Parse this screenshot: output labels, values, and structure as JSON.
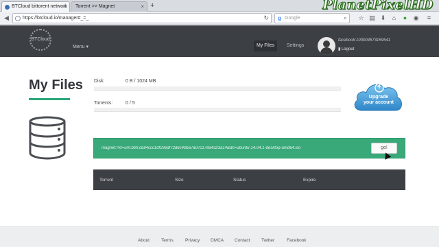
{
  "browser": {
    "tabs": [
      {
        "label": "BTCloud bittorent network",
        "close": "×"
      },
      {
        "label": "Torrent >> Magnet",
        "close": "×"
      }
    ],
    "new_tab": "+",
    "url": "https://btcloud.io/manager#_=_",
    "search_placeholder": "Google",
    "watermark": "PlanetPixelHD"
  },
  "header": {
    "logo_text": "BTCloud",
    "menu_label": "Menu ▾",
    "nav": {
      "my_files": "My Files",
      "settings": "Settings"
    },
    "user_name": "facebook:100004573159541",
    "logout_label": "▮ Logout"
  },
  "main": {
    "title": "My Files",
    "disk": {
      "label": "Disk:",
      "value": "0 B / 1024 MB",
      "fill_fraction": 0
    },
    "torrents": {
      "label": "Torrents:",
      "value": "0 / 5",
      "fill_fraction": 0
    },
    "upgrade_label_line1": "Upgrade",
    "upgrade_label_line2": "your account",
    "magnet_value": "magnet:?xt=urn:btih:cb84ccc10f296df72d6c40ba7a07c178a4323a14&dn=ubuntu-14.04.1-desktop-amd64.iso",
    "go_label": "go!",
    "table_columns": [
      "Torrent",
      "Size",
      "Status",
      "Expire"
    ]
  },
  "footer": {
    "links": [
      "About",
      "Terms",
      "Privacy",
      "DMCA",
      "Contact",
      "Twitter",
      "Facebook"
    ]
  },
  "colors": {
    "accent": "#29a877",
    "header_bg": "#3c3f44",
    "magnet_bg": "#3aa97a"
  }
}
